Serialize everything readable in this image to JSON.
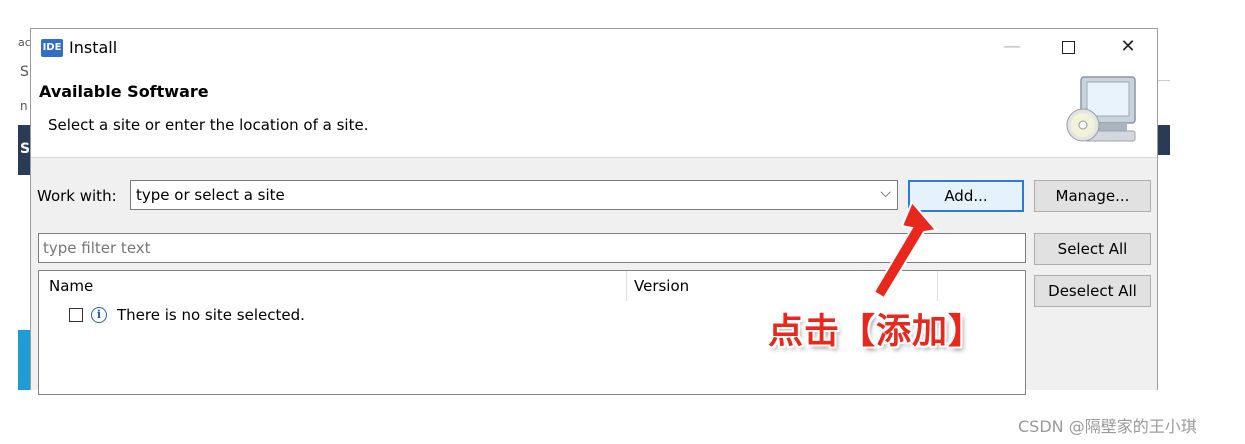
{
  "background_app": {
    "left_chars": [
      "ac",
      "S",
      "n",
      "S"
    ]
  },
  "window": {
    "icon_text": "IDE",
    "title": "Install",
    "controls": {
      "minimize": "—",
      "maximize": "",
      "close": "✕"
    }
  },
  "header": {
    "title": "Available Software",
    "subtitle": "Select a site or enter the location of a site.",
    "image": "monitor-cd-icon"
  },
  "work_with": {
    "label": "Work with:",
    "value": "type or select a site",
    "dropdown_icon": "chevron-down-icon"
  },
  "buttons": {
    "add": "Add...",
    "manage": "Manage...",
    "select_all": "Select All",
    "deselect_all": "Deselect All"
  },
  "filter": {
    "placeholder": "type filter text"
  },
  "table": {
    "columns": [
      "Name",
      "Version"
    ],
    "rows": [
      {
        "checked": false,
        "icon": "info-icon",
        "text": "There is no site selected."
      }
    ]
  },
  "annotation": {
    "text": "点击【添加】",
    "color": "#e8281c"
  },
  "watermark": "CSDN @隔壁家的王小琪",
  "colors": {
    "accent": "#2c7bd6",
    "dialog_bg": "#f0f0f0",
    "annotation": "#e8281c"
  }
}
